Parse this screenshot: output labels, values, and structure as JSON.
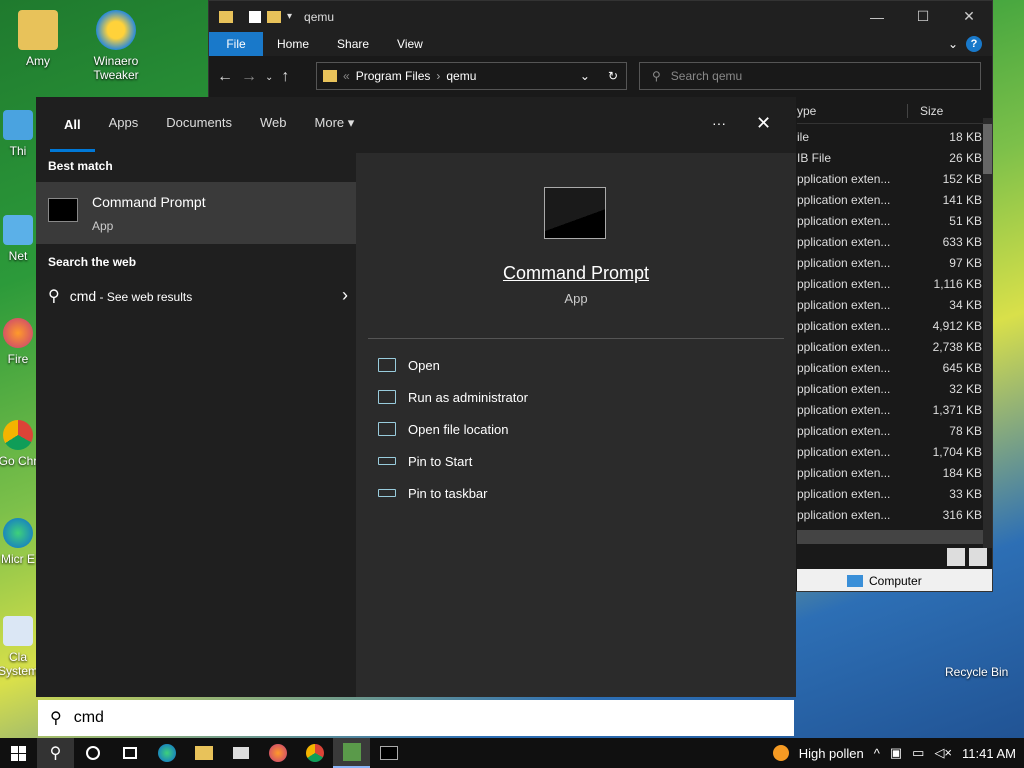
{
  "desktop": {
    "icons": [
      {
        "label": "Amy"
      },
      {
        "label": "Winaero Tweaker"
      },
      {
        "label": "Thi"
      },
      {
        "label": "Net"
      },
      {
        "label": "Fire"
      },
      {
        "label": "Go Chr"
      },
      {
        "label": "Micr E"
      },
      {
        "label": "Cla System"
      }
    ],
    "recycle_bin": "Recycle Bin"
  },
  "explorer": {
    "title": "qemu",
    "ribbon_tabs": [
      "File",
      "Home",
      "Share",
      "View"
    ],
    "breadcrumb": [
      "Program Files",
      "qemu"
    ],
    "search_placeholder": "Search qemu",
    "columns": {
      "type": "ype",
      "size": "Size"
    },
    "rows": [
      {
        "type": "ile",
        "size": "18 KB"
      },
      {
        "type": "IB File",
        "size": "26 KB"
      },
      {
        "type": "pplication exten...",
        "size": "152 KB"
      },
      {
        "type": "pplication exten...",
        "size": "141 KB"
      },
      {
        "type": "pplication exten...",
        "size": "51 KB"
      },
      {
        "type": "pplication exten...",
        "size": "633 KB"
      },
      {
        "type": "pplication exten...",
        "size": "97 KB"
      },
      {
        "type": "pplication exten...",
        "size": "1,116 KB"
      },
      {
        "type": "pplication exten...",
        "size": "34 KB"
      },
      {
        "type": "pplication exten...",
        "size": "4,912 KB"
      },
      {
        "type": "pplication exten...",
        "size": "2,738 KB"
      },
      {
        "type": "pplication exten...",
        "size": "645 KB"
      },
      {
        "type": "pplication exten...",
        "size": "32 KB"
      },
      {
        "type": "pplication exten...",
        "size": "1,371 KB"
      },
      {
        "type": "pplication exten...",
        "size": "78 KB"
      },
      {
        "type": "pplication exten...",
        "size": "1,704 KB"
      },
      {
        "type": "pplication exten...",
        "size": "184 KB"
      },
      {
        "type": "pplication exten...",
        "size": "33 KB"
      },
      {
        "type": "pplication exten...",
        "size": "316 KB"
      }
    ],
    "status_computer": "Computer"
  },
  "search": {
    "tabs": [
      "All",
      "Apps",
      "Documents",
      "Web",
      "More"
    ],
    "more_icon": "▾",
    "ellipsis": "···",
    "close": "✕",
    "best_match_title": "Best match",
    "best_match": {
      "name": "Command Prompt",
      "kind": "App"
    },
    "web_title": "Search the web",
    "web_query": "cmd",
    "web_suffix": " - See web results",
    "detail": {
      "name": "Command Prompt",
      "kind": "App"
    },
    "actions": [
      "Open",
      "Run as administrator",
      "Open file location",
      "Pin to Start",
      "Pin to taskbar"
    ],
    "query": "cmd"
  },
  "taskbar": {
    "weather": "High pollen",
    "time": "11:41 AM"
  }
}
